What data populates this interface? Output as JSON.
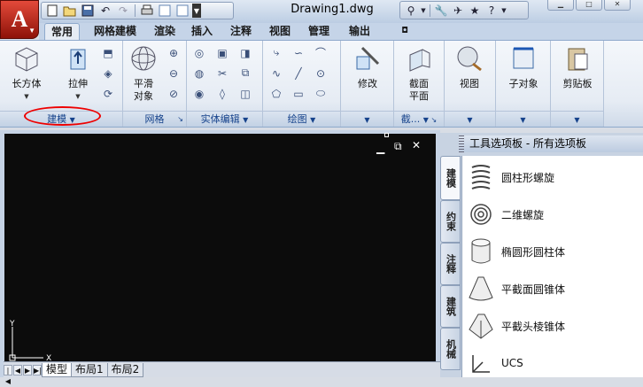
{
  "app": {
    "logo_letter": "A",
    "doc_title": "Drawing1.dwg"
  },
  "qat": {
    "icons": [
      "new-icon",
      "open-icon",
      "save-icon",
      "undo-icon",
      "redo-icon",
      "print-icon",
      "workspace-icon"
    ]
  },
  "tabs": [
    {
      "label": "常用",
      "active": true
    },
    {
      "label": "网格建模"
    },
    {
      "label": "渲染"
    },
    {
      "label": "插入"
    },
    {
      "label": "注释"
    },
    {
      "label": "视图"
    },
    {
      "label": "管理"
    },
    {
      "label": "输出"
    }
  ],
  "panels": {
    "modeling": {
      "title": "建模",
      "box": "长方体",
      "extrude": "拉伸"
    },
    "mesh": {
      "title": "网格",
      "smooth_line1": "平滑",
      "smooth_line2": "对象"
    },
    "solid_edit": {
      "title": "实体编辑"
    },
    "draw": {
      "title": "绘图"
    },
    "modify": {
      "label": "修改"
    },
    "section": {
      "label_line1": "截面",
      "label_line2": "平面",
      "title": "截..."
    },
    "view": {
      "label": "视图"
    },
    "subobject": {
      "label": "子对象"
    },
    "clipboard": {
      "label": "剪贴板"
    }
  },
  "viewport": {
    "axis_y": "Y",
    "axis_x": "X"
  },
  "layouts": [
    "模型",
    "布局1",
    "布局2"
  ],
  "palette": {
    "title": "工具选项板 - 所有选项板",
    "vtabs": [
      "建模",
      "约束",
      "注释",
      "建筑",
      "机械"
    ],
    "tools": [
      {
        "label": "圆柱形螺旋",
        "icon": "helix-icon"
      },
      {
        "label": "二维螺旋",
        "icon": "spiral-icon"
      },
      {
        "label": "椭圆形圆柱体",
        "icon": "elliptic-cylinder-icon"
      },
      {
        "label": "平截面圆锥体",
        "icon": "cone-frustum-icon"
      },
      {
        "label": "平截头棱锥体",
        "icon": "pyramid-frustum-icon"
      },
      {
        "label": "UCS",
        "icon": "ucs-icon"
      }
    ]
  },
  "colors": {
    "accent": "#c0180c",
    "highlight": "#e00000"
  }
}
